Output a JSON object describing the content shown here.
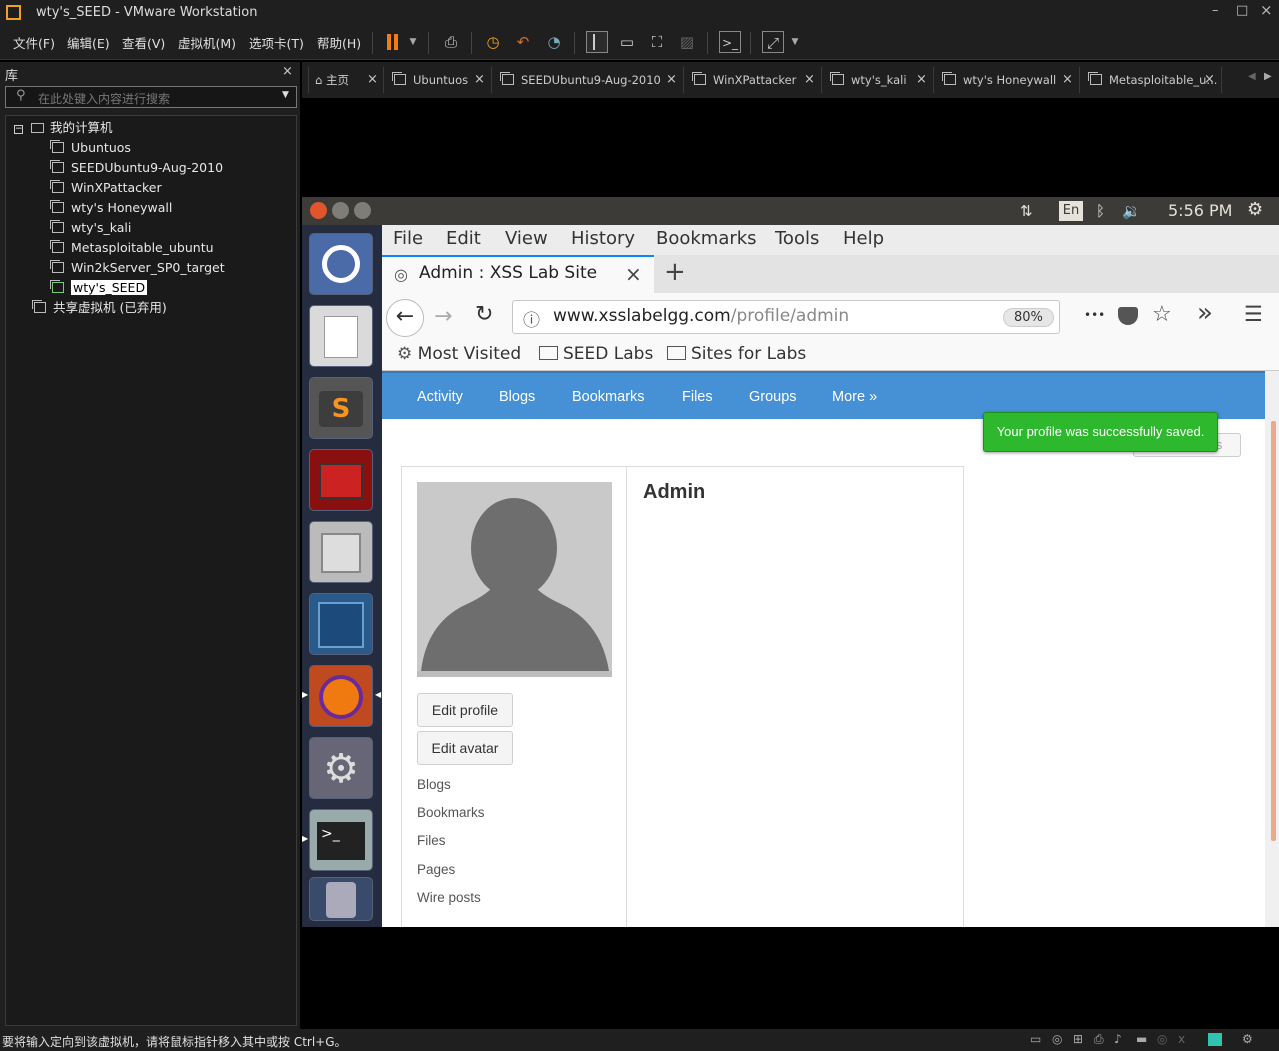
{
  "window": {
    "title": "wty's_SEED - VMware Workstation",
    "minimize": "–",
    "maximize": "□",
    "close": "×"
  },
  "vmware_menu": [
    "文件(F)",
    "编辑(E)",
    "查看(V)",
    "虚拟机(M)",
    "选项卡(T)",
    "帮助(H)"
  ],
  "library": {
    "header": "库",
    "close": "×",
    "search_placeholder": "在此处键入内容进行搜索",
    "root": "我的计算机",
    "expander": "−",
    "vms": [
      "Ubuntuos",
      "SEEDUbuntu9-Aug-2010",
      "WinXPattacker",
      "wty's Honeywall",
      "wty's_kali",
      "Metasploitable_ubuntu",
      "Win2kServer_SP0_target",
      "wty's_SEED"
    ],
    "shared": "共享虚拟机 (已弃用)"
  },
  "vm_tabs": [
    {
      "label": "主页"
    },
    {
      "label": "Ubuntuos"
    },
    {
      "label": "SEEDUbuntu9-Aug-2010"
    },
    {
      "label": "WinXPattacker"
    },
    {
      "label": "wty's_kali"
    },
    {
      "label": "wty's Honeywall"
    },
    {
      "label": "Metasploitable_u..."
    }
  ],
  "ubuntu_panel": {
    "lang": "En",
    "time": "5:56 PM"
  },
  "firefox": {
    "menu": [
      "File",
      "Edit",
      "View",
      "History",
      "Bookmarks",
      "Tools",
      "Help"
    ],
    "tab_title": "Admin : XSS Lab Site",
    "tab_close": "×",
    "new_tab": "+",
    "url_host": "www.xsslabelgg.com",
    "url_path": "/profile/admin",
    "zoom": "80%",
    "more": "•••",
    "overflow": "»",
    "hamburger": "☰",
    "bookmarks": [
      "Most Visited",
      "SEED Labs",
      "Sites for Labs"
    ]
  },
  "site": {
    "nav": [
      "Activity",
      "Blogs",
      "Bookmarks",
      "Files",
      "Groups",
      "More »"
    ],
    "toast": "Your profile was successfully saved.",
    "widget_button": "Add widgets",
    "profile_name": "Admin",
    "buttons": [
      "Edit profile",
      "Edit avatar"
    ],
    "links": [
      "Blogs",
      "Bookmarks",
      "Files",
      "Pages",
      "Wire posts"
    ]
  },
  "status_text": "要将输入定向到该虚拟机，请将鼠标指针移入其中或按 Ctrl+G。"
}
